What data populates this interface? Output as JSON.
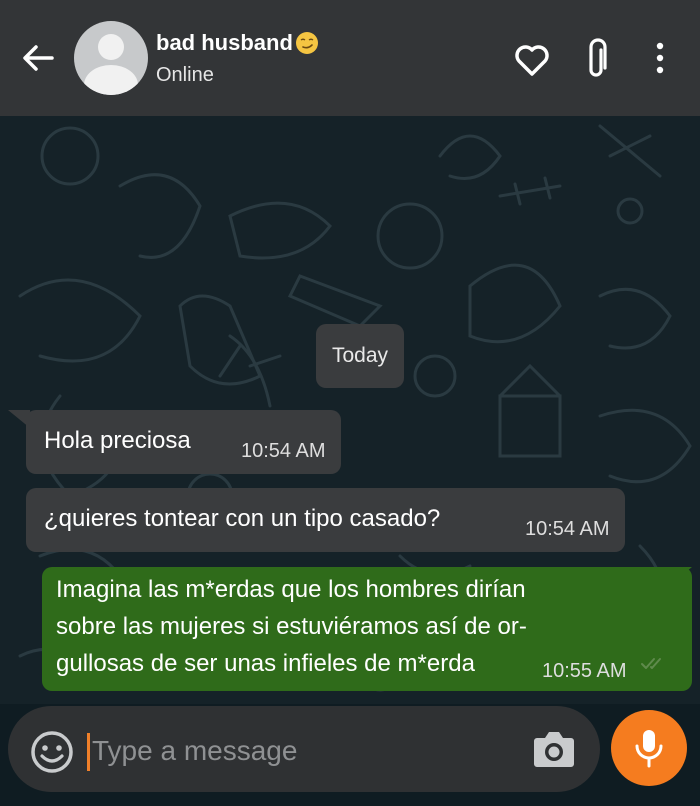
{
  "header": {
    "contact_name": "bad husband",
    "status": "Online",
    "icons": [
      "back-arrow-icon",
      "avatar-icon",
      "smirk-emoji",
      "heart-icon",
      "paperclip-icon",
      "more-vertical-icon"
    ]
  },
  "chat": {
    "date_separator": "Today",
    "messages": [
      {
        "direction": "incoming",
        "text": "Hola preciosa",
        "time": "10:54 AM"
      },
      {
        "direction": "incoming",
        "text": "¿quieres tontear con un tipo casado?",
        "time": "10:54 AM"
      },
      {
        "direction": "outgoing",
        "lines": [
          "Imagina las m*erdas que los hombres dirían",
          "sobre las mujeres si estuviéramos así de or-",
          "gullosas de ser unas infieles de m*erda"
        ],
        "time": "10:55 AM",
        "receipt": "delivered"
      }
    ]
  },
  "composer": {
    "placeholder": "Type a message",
    "value": "",
    "icons": [
      "emoji-icon",
      "camera-icon",
      "microphone-icon"
    ]
  },
  "colors": {
    "header_bg": "#333537",
    "chat_bg": "#152228",
    "incoming_bubble": "#3a3c3e",
    "outgoing_bubble": "#2f6b1a",
    "accent_orange": "#f57c1f"
  }
}
